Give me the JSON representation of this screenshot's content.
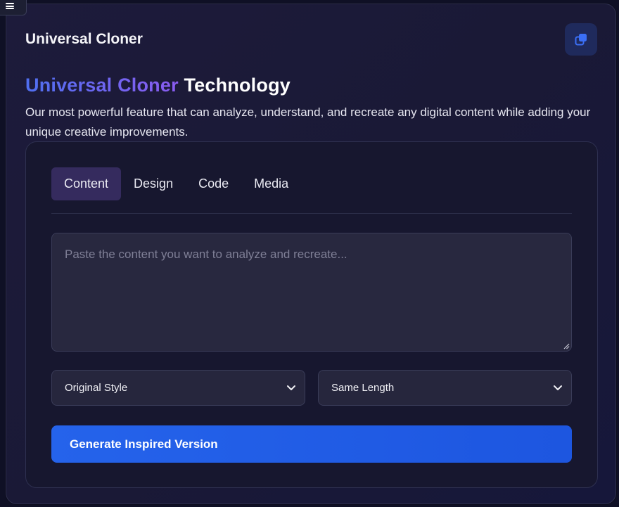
{
  "header": {
    "title": "Universal Cloner"
  },
  "hero": {
    "title_gradient": "Universal Cloner",
    "title_rest": "Technology",
    "description": "Our most powerful feature that can analyze, understand, and recreate any digital content while adding your unique creative improvements."
  },
  "tabs": [
    {
      "label": "Content",
      "active": true
    },
    {
      "label": "Design",
      "active": false
    },
    {
      "label": "Code",
      "active": false
    },
    {
      "label": "Media",
      "active": false
    }
  ],
  "input": {
    "placeholder": "Paste the content you want to analyze and recreate..."
  },
  "selects": {
    "style": {
      "value": "Original Style"
    },
    "length": {
      "value": "Same Length"
    }
  },
  "actions": {
    "generate_label": "Generate Inspired Version"
  },
  "icons": {
    "menu": "hamburger-icon",
    "copy": "copy-icon",
    "chevron": "chevron-down-icon"
  },
  "colors": {
    "accent": "#2563eb",
    "active_tab": "#352b5e",
    "gradient_start": "#4f6ff0",
    "gradient_end": "#8a5cf0"
  }
}
